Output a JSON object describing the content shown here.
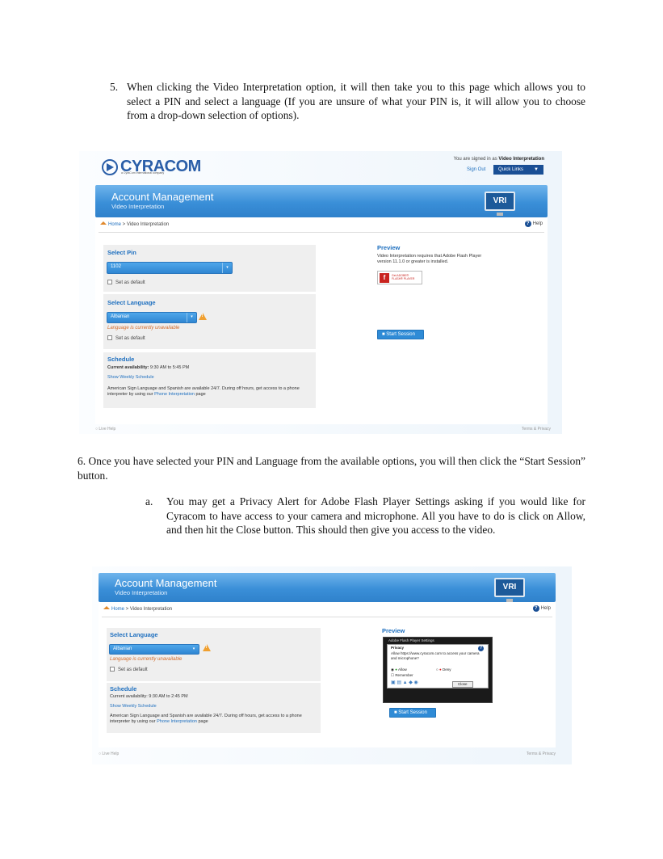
{
  "doc": {
    "step5_num": "5.",
    "step5_text": "When clicking the Video Interpretation option, it will then take you to this page which allows you to select a PIN and select a language (If you are unsure of what your PIN is, it will allow you to choose from a drop-down selection of options).",
    "step6_text": "6. Once you have selected your PIN and Language from the available options, you will then click the “Start Session” button.",
    "step6a_num": "a.",
    "step6a_text": "You may get a Privacy Alert for Adobe Flash Player Settings asking if you would like for Cyracom to have access to your camera and microphone. All you have to do is click on Allow, and then hit the Close button. This should then give you access to the video."
  },
  "shot1": {
    "logo": "CYRACOM",
    "logo_sub": "a CyraCom International company",
    "signed_prefix": "You are signed in as",
    "signed_user": "Video Interpretation",
    "sign_out": "Sign Out",
    "quick_links": "Quick Links",
    "quick_links_arrow": "▼",
    "banner_title": "Account Management",
    "banner_sub": "Video Interpretation",
    "vri": "VRI",
    "crumb_home": "Home",
    "crumb_rest": " > Video Interpretation",
    "help": "Help",
    "pin_title": "Select Pin",
    "pin_value": "1102",
    "pin_default": "Set as default",
    "lang_title": "Select Language",
    "lang_value": "Albanian",
    "lang_error": "Language is currently unavailable",
    "lang_default": "Set as default",
    "sched_title": "Schedule",
    "sched_avail_label": "Current availability:",
    "sched_avail": " 9:30 AM to 5:45 PM",
    "sched_weekly": "Show Weekly Schedule",
    "sched_note": "American Sign Language and Spanish are available 24/7. During off hours, get access to a phone interpreter by using our ",
    "sched_link": "Phone Interpretation",
    "sched_note_end": " page",
    "preview_title": "Preview",
    "preview_text": "Video Interpretation requires that Adobe Flash Player version 11.1.0 or greater is installed.",
    "flash_get": "Get ADOBE®",
    "flash_player": "FLASH® PLAYER",
    "start_btn": "Start Session",
    "live_help": "Live Help",
    "terms": "Terms & Privacy"
  },
  "shot2": {
    "banner_title": "Account Management",
    "banner_sub": "Video Interpretation",
    "vri": "VRI",
    "crumb_home": "Home",
    "crumb_rest": " > Video Interpretation",
    "help": "Help",
    "lang_title": "Select Language",
    "lang_value": "Albanian",
    "lang_error": "Language is currently unavailable",
    "lang_default": "Set as default",
    "sched_title": "Schedule",
    "sched_avail_label": "Current availability:",
    "sched_avail": " 9:30 AM to 2:45 PM",
    "sched_weekly": "Show Weekly Schedule",
    "sched_note": "American Sign Language and Spanish are available 24/7. During off hours, get access to a phone interpreter by using our ",
    "sched_link": "Phone Interpretation",
    "sched_note_end": " page",
    "preview_title": "Preview",
    "dlg_header": "Adobe Flash Player Settings",
    "dlg_privacy": "Privacy",
    "dlg_question": "Allow https://www.cyracom.com to access your camera and microphone?",
    "dlg_allow": "Allow",
    "dlg_deny": "Deny",
    "dlg_remember": "Remember",
    "dlg_close": "Close",
    "start_btn": "Start Session",
    "live_help": "Live Help",
    "terms": "Terms & Privacy"
  }
}
